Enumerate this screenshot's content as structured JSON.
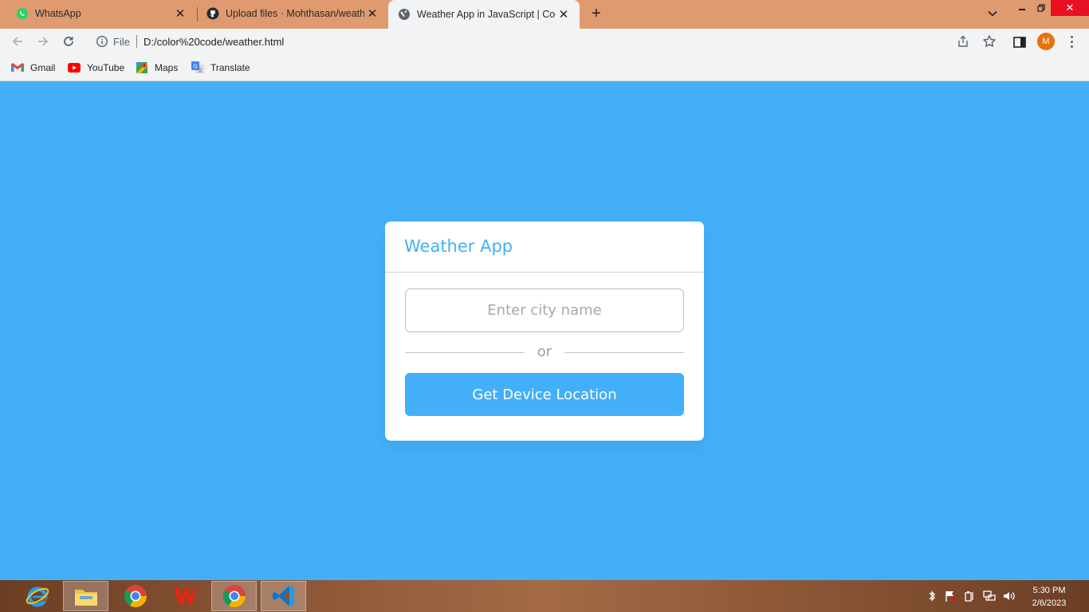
{
  "browser": {
    "tabs": [
      {
        "title": "WhatsApp",
        "icon": "whatsapp-icon",
        "active": false
      },
      {
        "title": "Upload files · Mohthasan/weathe",
        "icon": "github-icon",
        "active": false
      },
      {
        "title": "Weather App in JavaScript | Codi",
        "icon": "globe-icon",
        "active": true
      }
    ],
    "address": {
      "scheme": "File",
      "url": "D:/color%20code/weather.html"
    },
    "profile_initial": "M",
    "bookmarks": [
      {
        "label": "Gmail",
        "icon": "gmail-icon"
      },
      {
        "label": "YouTube",
        "icon": "youtube-icon"
      },
      {
        "label": "Maps",
        "icon": "maps-icon"
      },
      {
        "label": "Translate",
        "icon": "translate-icon"
      }
    ]
  },
  "app": {
    "title": "Weather App",
    "input_placeholder": "Enter city name",
    "input_value": "",
    "separator_text": "or",
    "location_button": "Get Device Location",
    "accent_color": "#43aff8"
  },
  "taskbar": {
    "apps": [
      "internet-explorer-icon",
      "file-explorer-icon",
      "chrome-icon",
      "wps-office-icon",
      "chrome-icon",
      "vscode-icon"
    ],
    "time": "5:30 PM",
    "date": "2/6/2023"
  }
}
